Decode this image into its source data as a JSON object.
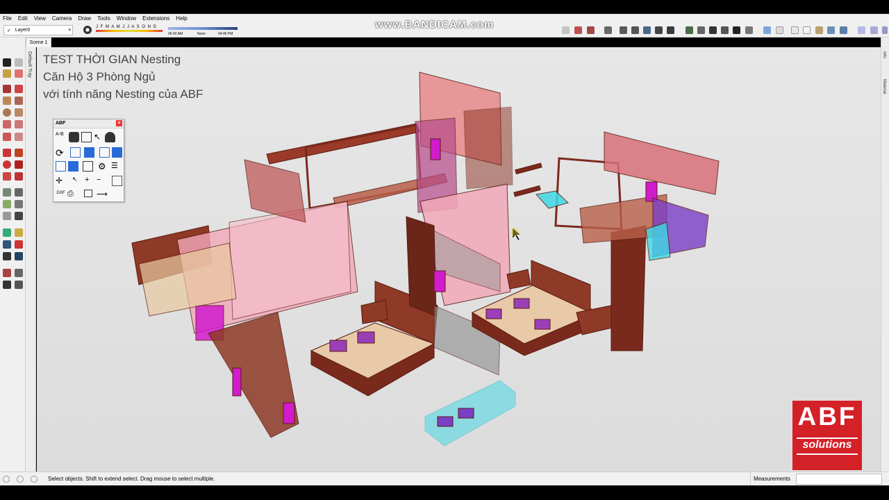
{
  "menu": [
    "File",
    "Edit",
    "View",
    "Camera",
    "Draw",
    "Tools",
    "Window",
    "Extensions",
    "Help"
  ],
  "layer": {
    "check": "✓",
    "name": "Layer0"
  },
  "shadow": {
    "months": "J F M A M J J A S O N D",
    "time_start": "06:42 AM",
    "time_mid": "Noon",
    "time_end": "04:46 PM"
  },
  "watermark": "www.BANDICAM.com",
  "scene_tab": "Scene 1",
  "tray_label": "Default Tray",
  "right_tabs": [
    "Info",
    "Material"
  ],
  "title_lines": [
    "TEST THỜI GIAN Nesting",
    "Căn Hộ 3 Phòng Ngủ",
    "với tính năng Nesting của ABF"
  ],
  "abf_panel": {
    "title": "ABF",
    "close": "×",
    "dxf_label": ".DXF",
    "ab_label": "A-B"
  },
  "status": {
    "text": "Select objects. Shift to extend select. Drag mouse to select multiple.",
    "measurements_label": "Measurements",
    "measurements_value": ""
  },
  "logo": {
    "big": "ABF",
    "sub": "solutions"
  },
  "colors": {
    "furniture_wood": "#7a2a1c",
    "panel_pink": "#f2a9b9",
    "panel_magenta": "#d21bcc",
    "panel_cyan": "#3ed9e6",
    "panel_purple": "#7b3fc6",
    "logo_red": "#d42027"
  }
}
